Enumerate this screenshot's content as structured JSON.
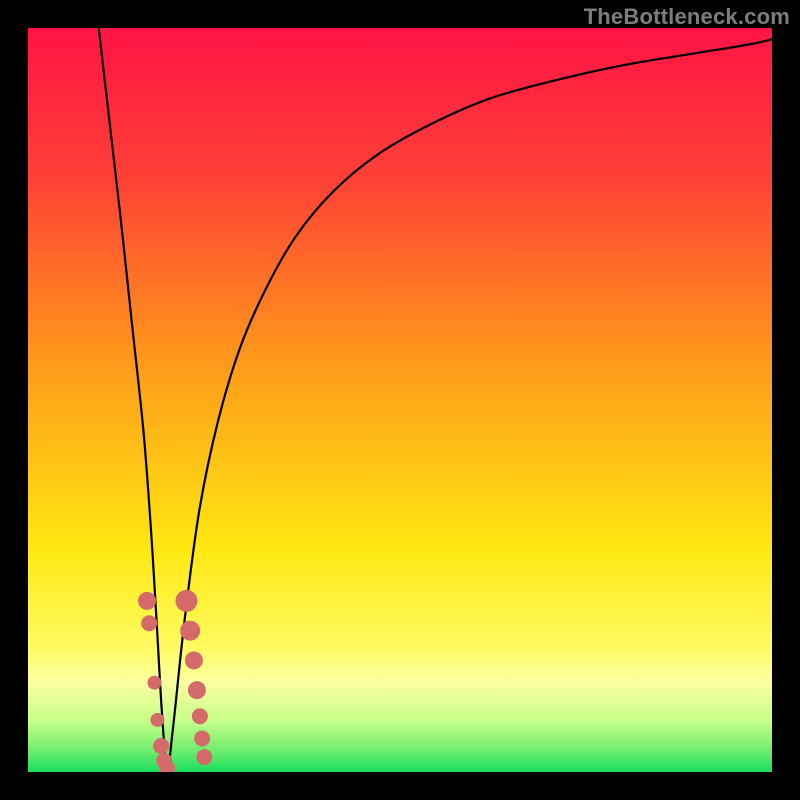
{
  "watermark": "TheBottleneck.com",
  "chart_data": {
    "type": "line",
    "title": "",
    "xlabel": "",
    "ylabel": "",
    "xlim": [
      0,
      100
    ],
    "ylim": [
      0,
      100
    ],
    "gradient_stops": [
      {
        "offset": 0,
        "color": "#ff1445"
      },
      {
        "offset": 20,
        "color": "#ff4036"
      },
      {
        "offset": 45,
        "color": "#ff9a1a"
      },
      {
        "offset": 70,
        "color": "#ffe812"
      },
      {
        "offset": 83,
        "color": "#fffb60"
      },
      {
        "offset": 88,
        "color": "#fbffa0"
      },
      {
        "offset": 93,
        "color": "#c7ff8a"
      },
      {
        "offset": 97,
        "color": "#73ee6e"
      },
      {
        "offset": 100,
        "color": "#1bdf5f"
      }
    ],
    "series": [
      {
        "name": "bottleneck-curve",
        "x": [
          9.5,
          11,
          12.5,
          14,
          15.5,
          16.5,
          17.3,
          18.0,
          18.7,
          19.5,
          21,
          23,
          25.5,
          28.5,
          32,
          36,
          41,
          47,
          54,
          62,
          71,
          80,
          89,
          97,
          100
        ],
        "y": [
          100,
          87,
          74,
          60,
          46,
          33,
          20,
          8,
          0.5,
          6,
          20,
          35,
          47,
          57,
          65,
          72,
          78,
          83,
          87,
          90.5,
          93,
          95,
          96.5,
          97.8,
          98.5
        ]
      }
    ],
    "markers": {
      "name": "highlighted-points",
      "color": "#d46a6a",
      "points": [
        {
          "x": 16.0,
          "y": 23.0,
          "r": 9
        },
        {
          "x": 16.3,
          "y": 20.0,
          "r": 8
        },
        {
          "x": 17.0,
          "y": 12.0,
          "r": 7
        },
        {
          "x": 17.4,
          "y": 7.0,
          "r": 7
        },
        {
          "x": 17.9,
          "y": 3.5,
          "r": 8
        },
        {
          "x": 18.3,
          "y": 1.5,
          "r": 8
        },
        {
          "x": 18.7,
          "y": 0.5,
          "r": 8
        },
        {
          "x": 21.3,
          "y": 23.0,
          "r": 11
        },
        {
          "x": 21.8,
          "y": 19.0,
          "r": 10
        },
        {
          "x": 22.3,
          "y": 15.0,
          "r": 9
        },
        {
          "x": 22.7,
          "y": 11.0,
          "r": 9
        },
        {
          "x": 23.1,
          "y": 7.5,
          "r": 8
        },
        {
          "x": 23.4,
          "y": 4.5,
          "r": 8
        },
        {
          "x": 23.7,
          "y": 2.0,
          "r": 8
        }
      ]
    }
  }
}
